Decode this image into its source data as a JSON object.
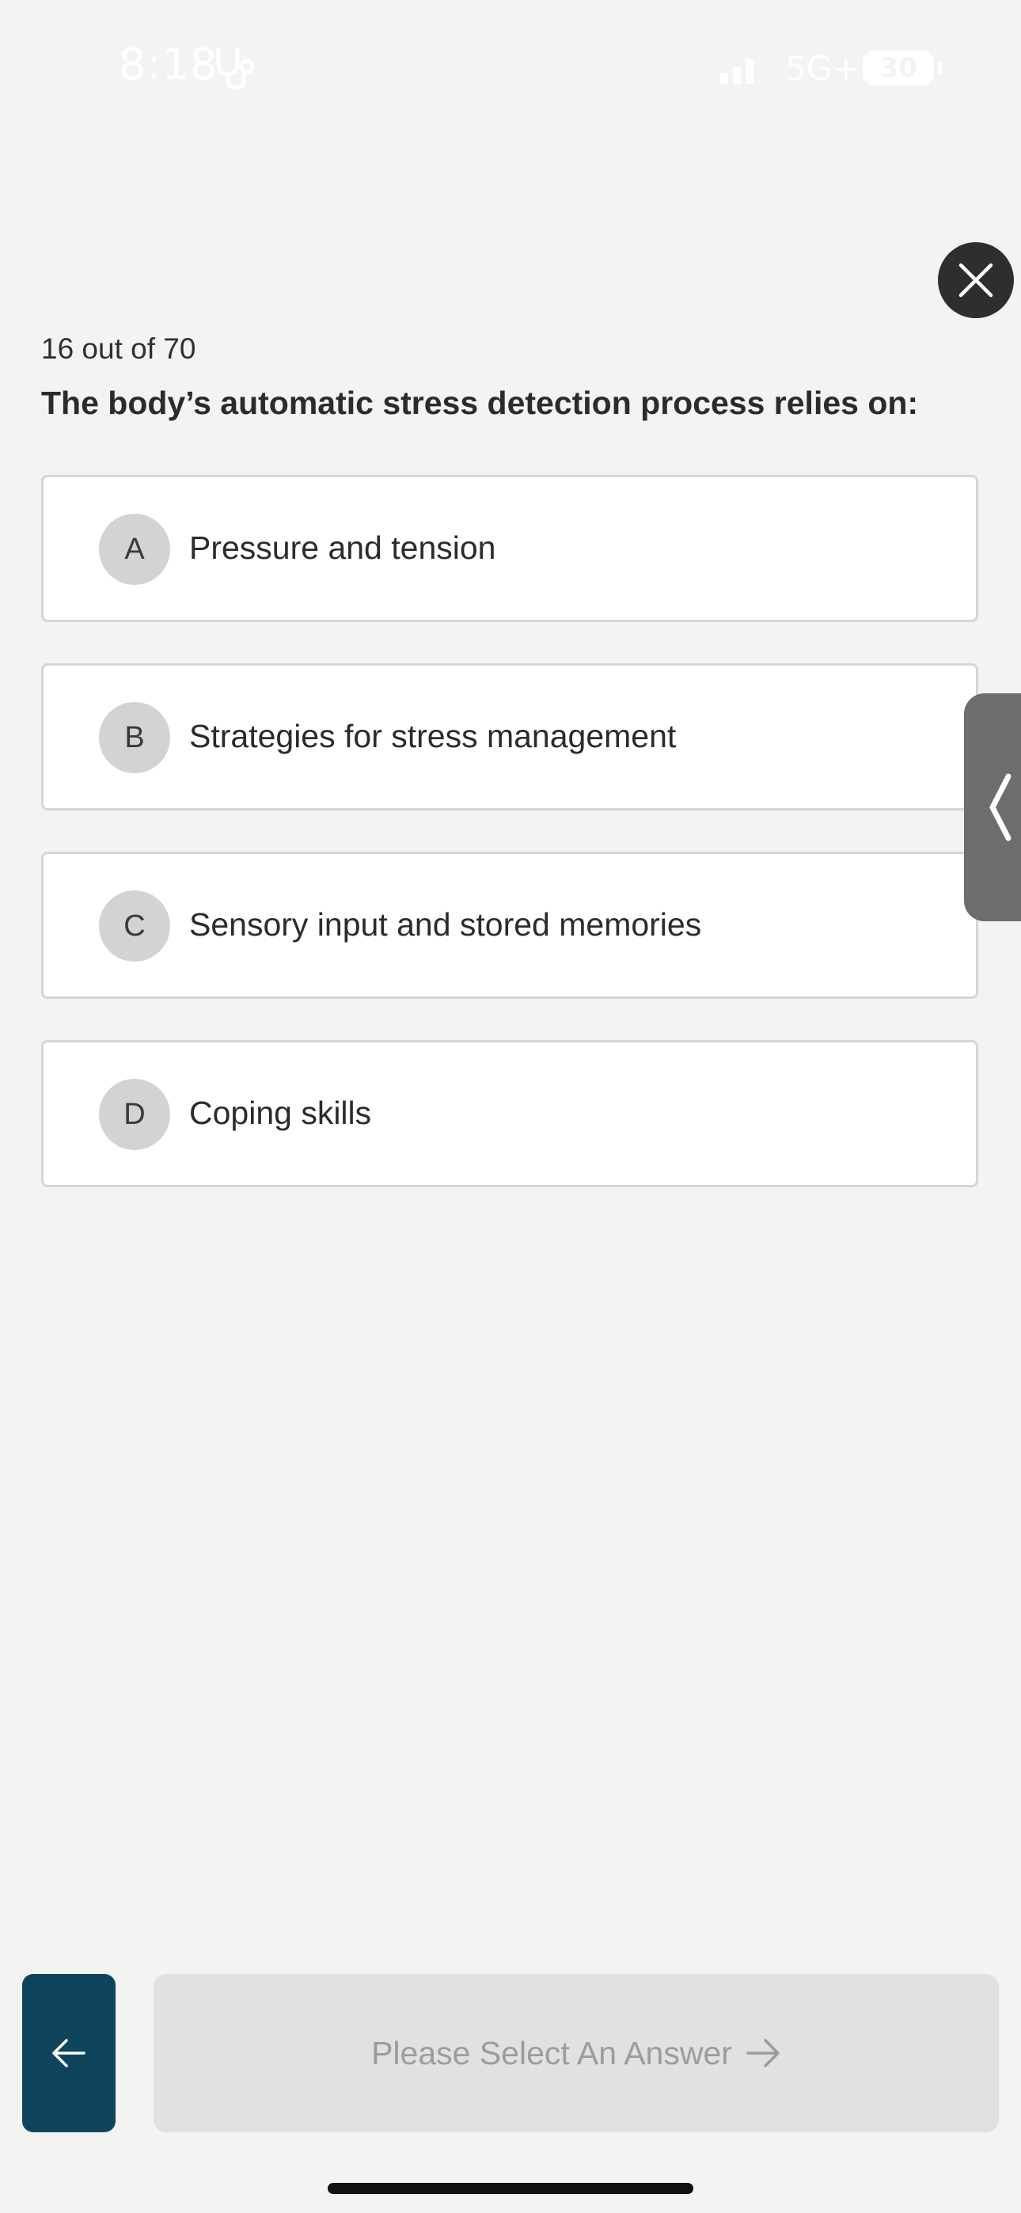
{
  "status_bar": {
    "time": "8:18",
    "network": "5G+",
    "battery": "30"
  },
  "quiz": {
    "progress": "16 out of 70",
    "question": "The body’s automatic stress detection process relies on:",
    "options": [
      {
        "letter": "A",
        "text": "Pressure and tension"
      },
      {
        "letter": "B",
        "text": "Strategies for stress management"
      },
      {
        "letter": "C",
        "text": "Sensory input and stored memories"
      },
      {
        "letter": "D",
        "text": "Coping skills"
      }
    ]
  },
  "footer": {
    "next_label": "Please Select An Answer"
  },
  "icons": {
    "close": "close-icon",
    "back": "arrow-left-icon",
    "next": "arrow-right-icon",
    "drawer": "chevron-left-icon",
    "health": "stethoscope-icon"
  },
  "colors": {
    "background": "#f3f3f2",
    "back_button": "#0f455c",
    "close_button": "#2e2e2e",
    "disabled_button": "#e1e1e1",
    "side_tab": "#6d6d6d"
  }
}
